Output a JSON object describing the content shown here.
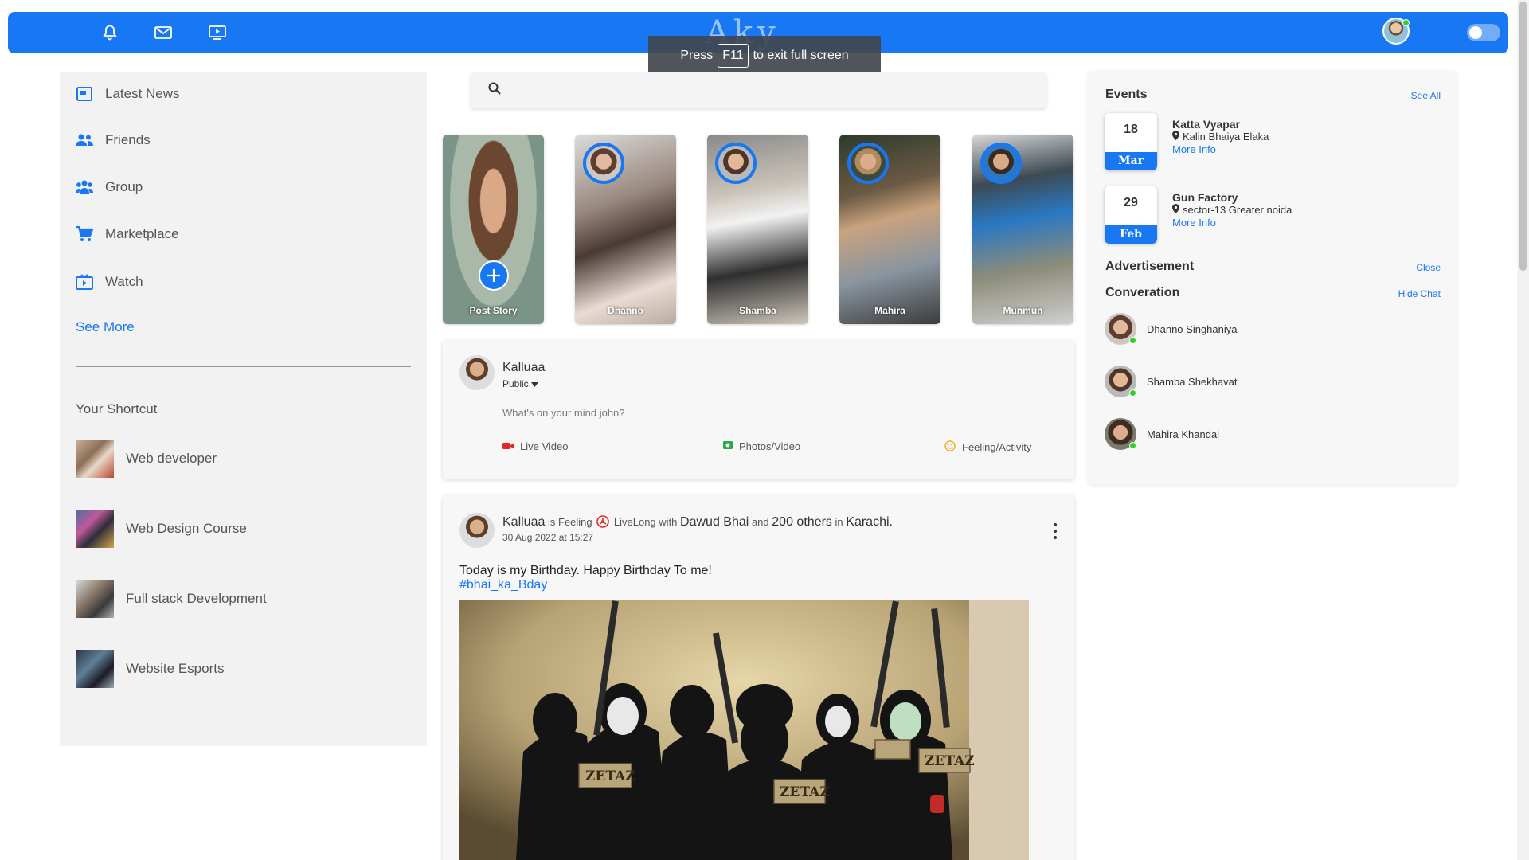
{
  "navbar": {
    "logo": "Aky",
    "icons": [
      "bell-icon",
      "mail-icon",
      "video-icon"
    ]
  },
  "toast": {
    "prefix": "Press",
    "key": "F11",
    "suffix": "to exit full screen"
  },
  "sidebar": {
    "items": [
      {
        "label": "Latest News",
        "icon": "news-icon"
      },
      {
        "label": "Friends",
        "icon": "friends-icon"
      },
      {
        "label": "Group",
        "icon": "group-icon"
      },
      {
        "label": "Marketplace",
        "icon": "cart-icon"
      },
      {
        "label": "Watch",
        "icon": "tv-icon"
      }
    ],
    "see_more": "See More",
    "shortcut_title": "Your Shortcut",
    "shortcuts": [
      {
        "label": "Web developer"
      },
      {
        "label": "Web Design Course"
      },
      {
        "label": "Full stack Development"
      },
      {
        "label": "Website Esports"
      }
    ]
  },
  "search": {
    "placeholder": ""
  },
  "stories": [
    {
      "name": "Post Story"
    },
    {
      "name": "Dhanno"
    },
    {
      "name": "Shamba"
    },
    {
      "name": "Mahira"
    },
    {
      "name": "Munmun"
    }
  ],
  "share": {
    "user": "Kalluaa",
    "privacy": "Public",
    "placeholder": "What's on your mind john?",
    "options": [
      {
        "label": "Live Video",
        "icon": "live-video-icon",
        "color": "#e02a2a"
      },
      {
        "label": "Photos/Video",
        "icon": "photo-icon",
        "color": "#2aa84a"
      },
      {
        "label": "Feeling/Activity",
        "icon": "smile-icon",
        "color": "#f0b429"
      }
    ]
  },
  "post": {
    "user": "Kalluaa",
    "is_feeling": "is Feeling",
    "feeling": "LiveLong",
    "with": "with",
    "friend": "Dawud Bhai",
    "and": "and",
    "others": "200 others",
    "in": "in",
    "place": "Karachi.",
    "date": "30 Aug 2022 at 15:27",
    "text": "Today is my Birthday. Happy Birthday To me!",
    "hashtag": "#bhai_ka_Bday"
  },
  "events": {
    "title": "Events",
    "see_all": "See All",
    "items": [
      {
        "day": "18",
        "month": "Mar",
        "title": "Katta Vyapar",
        "location": "Kalin Bhaiya Elaka",
        "more": "More Info"
      },
      {
        "day": "29",
        "month": "Feb",
        "title": "Gun Factory",
        "location": "sector-13 Greater noida",
        "more": "More Info"
      }
    ]
  },
  "advertisement": {
    "title": "Advertisement",
    "close": "Close"
  },
  "conversation": {
    "title": "Converation",
    "hide": "Hide Chat",
    "contacts": [
      {
        "name": "Dhanno Singhaniya"
      },
      {
        "name": "Shamba Shekhavat"
      },
      {
        "name": "Mahira Khandal"
      }
    ]
  },
  "colors": {
    "primary": "#1877f2",
    "online": "#31d031"
  }
}
